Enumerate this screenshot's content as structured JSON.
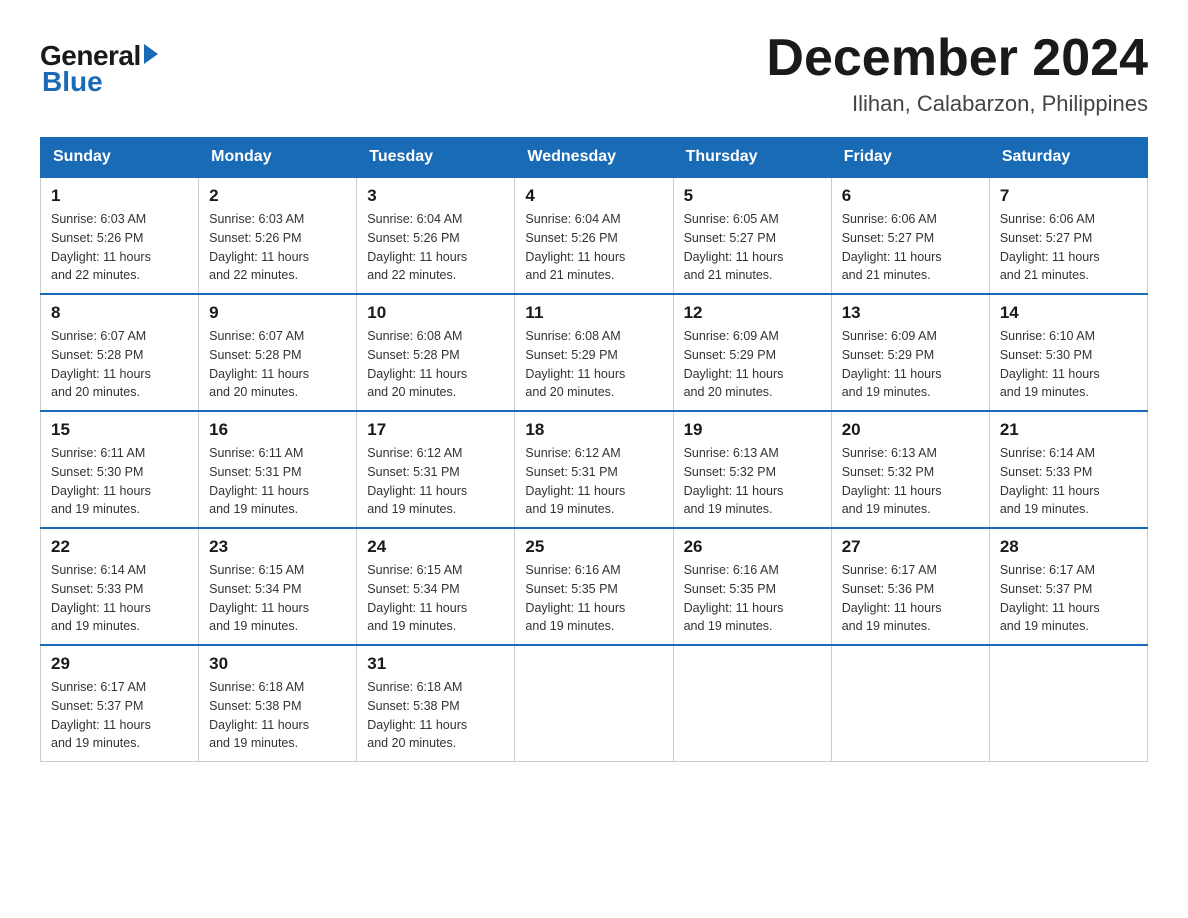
{
  "logo": {
    "general": "General",
    "blue": "Blue",
    "arrow_color": "#1a6bb5"
  },
  "header": {
    "month_title": "December 2024",
    "location": "Ilihan, Calabarzon, Philippines"
  },
  "weekdays": [
    "Sunday",
    "Monday",
    "Tuesday",
    "Wednesday",
    "Thursday",
    "Friday",
    "Saturday"
  ],
  "weeks": [
    [
      {
        "day": "1",
        "sunrise": "6:03 AM",
        "sunset": "5:26 PM",
        "daylight": "11 hours and 22 minutes."
      },
      {
        "day": "2",
        "sunrise": "6:03 AM",
        "sunset": "5:26 PM",
        "daylight": "11 hours and 22 minutes."
      },
      {
        "day": "3",
        "sunrise": "6:04 AM",
        "sunset": "5:26 PM",
        "daylight": "11 hours and 22 minutes."
      },
      {
        "day": "4",
        "sunrise": "6:04 AM",
        "sunset": "5:26 PM",
        "daylight": "11 hours and 21 minutes."
      },
      {
        "day": "5",
        "sunrise": "6:05 AM",
        "sunset": "5:27 PM",
        "daylight": "11 hours and 21 minutes."
      },
      {
        "day": "6",
        "sunrise": "6:06 AM",
        "sunset": "5:27 PM",
        "daylight": "11 hours and 21 minutes."
      },
      {
        "day": "7",
        "sunrise": "6:06 AM",
        "sunset": "5:27 PM",
        "daylight": "11 hours and 21 minutes."
      }
    ],
    [
      {
        "day": "8",
        "sunrise": "6:07 AM",
        "sunset": "5:28 PM",
        "daylight": "11 hours and 20 minutes."
      },
      {
        "day": "9",
        "sunrise": "6:07 AM",
        "sunset": "5:28 PM",
        "daylight": "11 hours and 20 minutes."
      },
      {
        "day": "10",
        "sunrise": "6:08 AM",
        "sunset": "5:28 PM",
        "daylight": "11 hours and 20 minutes."
      },
      {
        "day": "11",
        "sunrise": "6:08 AM",
        "sunset": "5:29 PM",
        "daylight": "11 hours and 20 minutes."
      },
      {
        "day": "12",
        "sunrise": "6:09 AM",
        "sunset": "5:29 PM",
        "daylight": "11 hours and 20 minutes."
      },
      {
        "day": "13",
        "sunrise": "6:09 AM",
        "sunset": "5:29 PM",
        "daylight": "11 hours and 19 minutes."
      },
      {
        "day": "14",
        "sunrise": "6:10 AM",
        "sunset": "5:30 PM",
        "daylight": "11 hours and 19 minutes."
      }
    ],
    [
      {
        "day": "15",
        "sunrise": "6:11 AM",
        "sunset": "5:30 PM",
        "daylight": "11 hours and 19 minutes."
      },
      {
        "day": "16",
        "sunrise": "6:11 AM",
        "sunset": "5:31 PM",
        "daylight": "11 hours and 19 minutes."
      },
      {
        "day": "17",
        "sunrise": "6:12 AM",
        "sunset": "5:31 PM",
        "daylight": "11 hours and 19 minutes."
      },
      {
        "day": "18",
        "sunrise": "6:12 AM",
        "sunset": "5:31 PM",
        "daylight": "11 hours and 19 minutes."
      },
      {
        "day": "19",
        "sunrise": "6:13 AM",
        "sunset": "5:32 PM",
        "daylight": "11 hours and 19 minutes."
      },
      {
        "day": "20",
        "sunrise": "6:13 AM",
        "sunset": "5:32 PM",
        "daylight": "11 hours and 19 minutes."
      },
      {
        "day": "21",
        "sunrise": "6:14 AM",
        "sunset": "5:33 PM",
        "daylight": "11 hours and 19 minutes."
      }
    ],
    [
      {
        "day": "22",
        "sunrise": "6:14 AM",
        "sunset": "5:33 PM",
        "daylight": "11 hours and 19 minutes."
      },
      {
        "day": "23",
        "sunrise": "6:15 AM",
        "sunset": "5:34 PM",
        "daylight": "11 hours and 19 minutes."
      },
      {
        "day": "24",
        "sunrise": "6:15 AM",
        "sunset": "5:34 PM",
        "daylight": "11 hours and 19 minutes."
      },
      {
        "day": "25",
        "sunrise": "6:16 AM",
        "sunset": "5:35 PM",
        "daylight": "11 hours and 19 minutes."
      },
      {
        "day": "26",
        "sunrise": "6:16 AM",
        "sunset": "5:35 PM",
        "daylight": "11 hours and 19 minutes."
      },
      {
        "day": "27",
        "sunrise": "6:17 AM",
        "sunset": "5:36 PM",
        "daylight": "11 hours and 19 minutes."
      },
      {
        "day": "28",
        "sunrise": "6:17 AM",
        "sunset": "5:37 PM",
        "daylight": "11 hours and 19 minutes."
      }
    ],
    [
      {
        "day": "29",
        "sunrise": "6:17 AM",
        "sunset": "5:37 PM",
        "daylight": "11 hours and 19 minutes."
      },
      {
        "day": "30",
        "sunrise": "6:18 AM",
        "sunset": "5:38 PM",
        "daylight": "11 hours and 19 minutes."
      },
      {
        "day": "31",
        "sunrise": "6:18 AM",
        "sunset": "5:38 PM",
        "daylight": "11 hours and 20 minutes."
      },
      null,
      null,
      null,
      null
    ]
  ],
  "labels": {
    "sunrise": "Sunrise:",
    "sunset": "Sunset:",
    "daylight": "Daylight:"
  }
}
